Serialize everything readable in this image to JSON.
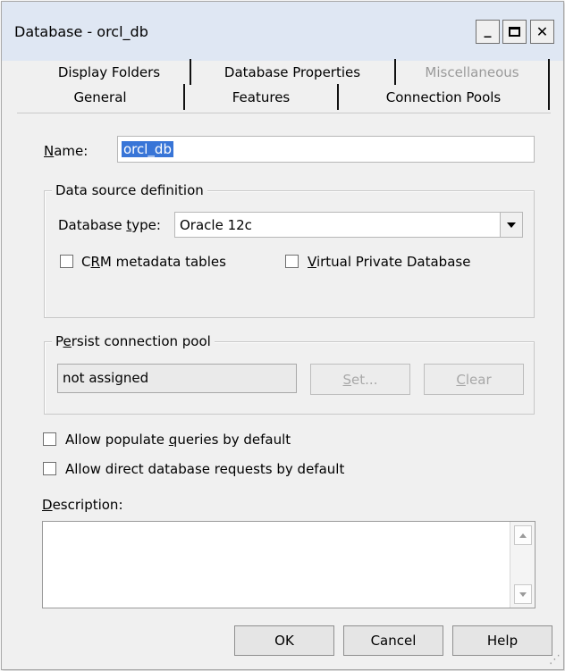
{
  "window": {
    "title": "Database - orcl_db",
    "minimize_glyph": "_",
    "maximize_glyph": "☐",
    "close_glyph": "✕"
  },
  "tabs": {
    "top_row": [
      {
        "label": "Display Folders",
        "enabled": true
      },
      {
        "label": "Database Properties",
        "enabled": true
      },
      {
        "label": "Miscellaneous",
        "enabled": false
      }
    ],
    "bottom_row": [
      {
        "label": "General",
        "active": true
      },
      {
        "label": "Features",
        "active": false
      },
      {
        "label": "Connection Pools",
        "active": false
      }
    ]
  },
  "name_field": {
    "label_first": "N",
    "label_rest": "ame:",
    "value": "orcl_db"
  },
  "data_source": {
    "legend": "Data source definition",
    "db_type_label_first": "Database ",
    "db_type_label_u": "t",
    "db_type_label_rest": "ype:",
    "db_type_value": "Oracle 12c",
    "crm_label_first": "C",
    "crm_label_u": "R",
    "crm_label_rest": "M metadata tables",
    "crm_checked": false,
    "vpd_label_u": "V",
    "vpd_label_rest": "irtual Private Database",
    "vpd_checked": false
  },
  "persist_pool": {
    "legend_first": "P",
    "legend_u": "e",
    "legend_rest": "rsist connection pool",
    "value": "not assigned",
    "set_label_u": "S",
    "set_label_rest": "et...",
    "clear_label_u": "C",
    "clear_label_rest": "lear"
  },
  "options": {
    "populate_first": "Allow populate ",
    "populate_u": "q",
    "populate_rest": "ueries by default",
    "populate_checked": false,
    "direct_first": "Allow direct database requests by default",
    "direct_checked": false
  },
  "description": {
    "label_u": "D",
    "label_rest": "escription:",
    "value": ""
  },
  "buttons": {
    "ok": "OK",
    "cancel": "Cancel",
    "help": "Help"
  }
}
